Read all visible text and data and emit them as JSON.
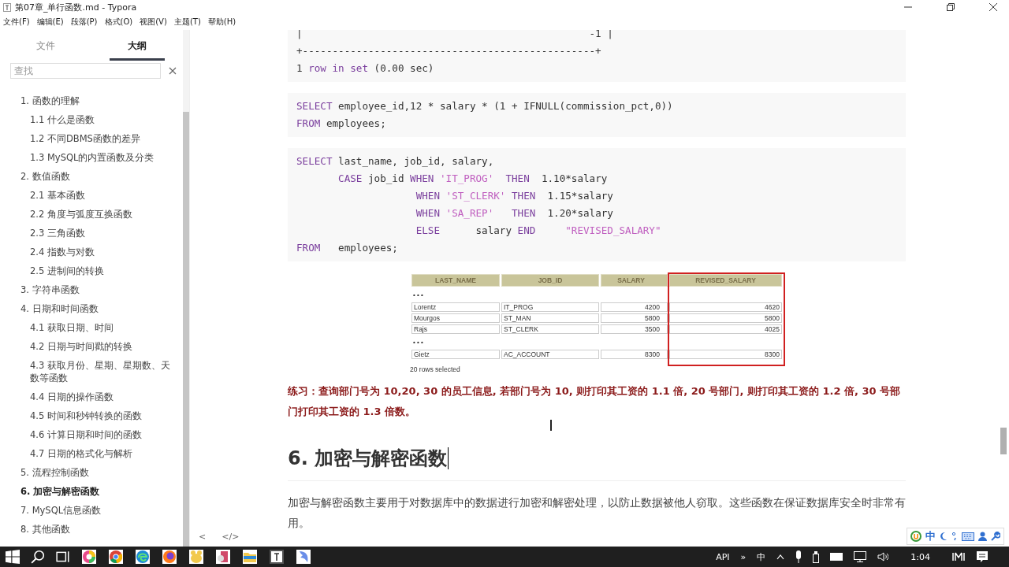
{
  "window": {
    "title": "第07章_单行函数.md - Typora"
  },
  "menu": [
    "文件(F)",
    "编辑(E)",
    "段落(P)",
    "格式(O)",
    "视图(V)",
    "主题(T)",
    "帮助(H)"
  ],
  "sidebar": {
    "tabs": [
      {
        "label": "文件",
        "selected": false
      },
      {
        "label": "大纲",
        "selected": true
      }
    ],
    "search": {
      "placeholder": "查找"
    },
    "outline": [
      {
        "label": "1. 函数的理解",
        "selected": false,
        "children": [
          {
            "label": "1.1 什么是函数",
            "selected": false
          },
          {
            "label": "1.2 不同DBMS函数的差异",
            "selected": false
          },
          {
            "label": "1.3 MySQL的内置函数及分类",
            "selected": false
          }
        ]
      },
      {
        "label": "2. 数值函数",
        "selected": false,
        "children": [
          {
            "label": "2.1 基本函数",
            "selected": false
          },
          {
            "label": "2.2 角度与弧度互换函数",
            "selected": false
          },
          {
            "label": "2.3 三角函数",
            "selected": false
          },
          {
            "label": "2.4 指数与对数",
            "selected": false
          },
          {
            "label": "2.5 进制间的转换",
            "selected": false
          }
        ]
      },
      {
        "label": "3. 字符串函数",
        "selected": false
      },
      {
        "label": "4. 日期和时间函数",
        "selected": false,
        "children": [
          {
            "label": "4.1 获取日期、时间",
            "selected": false
          },
          {
            "label": "4.2 日期与时间戳的转换",
            "selected": false
          },
          {
            "label": "4.3 获取月份、星期、星期数、天数等函数",
            "selected": false
          },
          {
            "label": "4.4 日期的操作函数",
            "selected": false
          },
          {
            "label": "4.5 时间和秒钟转换的函数",
            "selected": false
          },
          {
            "label": "4.6 计算日期和时间的函数",
            "selected": false
          },
          {
            "label": "4.7 日期的格式化与解析",
            "selected": false
          }
        ]
      },
      {
        "label": "5. 流程控制函数",
        "selected": false
      },
      {
        "label": "6. 加密与解密函数",
        "selected": true
      },
      {
        "label": "7. MySQL信息函数",
        "selected": false
      },
      {
        "label": "8. 其他函数",
        "selected": false
      }
    ],
    "footer": [
      "<",
      "</>"
    ]
  },
  "code_blocks": [
    [
      [
        {
          "text": "|                                                -1 |",
          "kind": "plain"
        }
      ],
      [
        {
          "text": "+-------------------------------------------------+",
          "kind": "plain"
        }
      ],
      [
        {
          "text": "1 ",
          "kind": "plain"
        },
        {
          "text": "row in set",
          "kind": "kw"
        },
        {
          "text": " (0.00 sec)",
          "kind": "plain"
        }
      ]
    ],
    [
      [
        {
          "text": "SELECT",
          "kind": "kw"
        },
        {
          "text": " employee_id,12 * salary * (1 + IFNULL(commission_pct,0))",
          "kind": "plain"
        }
      ],
      [
        {
          "text": "FROM",
          "kind": "kw"
        },
        {
          "text": " employees;",
          "kind": "plain"
        }
      ]
    ],
    [
      [
        {
          "text": "SELECT",
          "kind": "kw"
        },
        {
          "text": " last_name, job_id, salary,",
          "kind": "plain"
        }
      ],
      [
        {
          "text": "       CASE",
          "kind": "kw"
        },
        {
          "text": " job_id ",
          "kind": "plain"
        },
        {
          "text": "WHEN",
          "kind": "kw"
        },
        {
          "text": " 'IT_PROG'",
          "kind": "str"
        },
        {
          "text": "  THEN",
          "kind": "kw"
        },
        {
          "text": "  1.10*salary",
          "kind": "plain"
        }
      ],
      [
        {
          "text": "                    WHEN",
          "kind": "kw"
        },
        {
          "text": " 'ST_CLERK'",
          "kind": "str"
        },
        {
          "text": " THEN",
          "kind": "kw"
        },
        {
          "text": "  1.15*salary",
          "kind": "plain"
        }
      ],
      [
        {
          "text": "                    WHEN",
          "kind": "kw"
        },
        {
          "text": " 'SA_REP'",
          "kind": "str"
        },
        {
          "text": "   THEN",
          "kind": "kw"
        },
        {
          "text": "  1.20*salary",
          "kind": "plain"
        }
      ],
      [
        {
          "text": "                    ELSE",
          "kind": "kw"
        },
        {
          "text": "      salary ",
          "kind": "plain"
        },
        {
          "text": "END",
          "kind": "kw"
        },
        {
          "text": "     \"REVISED_SALARY\"",
          "kind": "str"
        }
      ],
      [
        {
          "text": "FROM",
          "kind": "kw"
        },
        {
          "text": "   employees;",
          "kind": "plain"
        }
      ]
    ]
  ],
  "result_table": {
    "columns": [
      "LAST_NAME",
      "JOB_ID",
      "SALARY",
      "REVISED_SALARY"
    ],
    "rows": [
      {
        "kind": "gap",
        "mark": "• • •"
      },
      {
        "kind": "data",
        "cells": [
          "Lorentz",
          "IT_PROG",
          "4200",
          "4620"
        ]
      },
      {
        "kind": "data",
        "cells": [
          "Mourgos",
          "ST_MAN",
          "5800",
          "5800"
        ]
      },
      {
        "kind": "data",
        "cells": [
          "Rajs",
          "ST_CLERK",
          "3500",
          "4025"
        ]
      },
      {
        "kind": "gap",
        "mark": "• • •"
      },
      {
        "kind": "data",
        "cells": [
          "Gietz",
          "AC_ACCOUNT",
          "8300",
          "8300"
        ]
      }
    ],
    "footer": "20 rows selected"
  },
  "exercise": "练习：查询部门号为 10,20, 30 的员工信息, 若部门号为 10, 则打印其工资的 1.1 倍, 20 号部门, 则打印其工资的 1.2 倍, 30 号部门打印其工资的 1.3 倍数。",
  "heading": "6. 加密与解密函数",
  "paragraph": "加密与解密函数主要用于对数据库中的数据进行加密和解密处理，以防止数据被他人窃取。这些函数在保证数据库安全时非常有用。",
  "ime_bar": {
    "label": "中"
  },
  "taskbar": {
    "tray": [
      "API",
      "»",
      "中"
    ],
    "time": "1:04"
  }
}
